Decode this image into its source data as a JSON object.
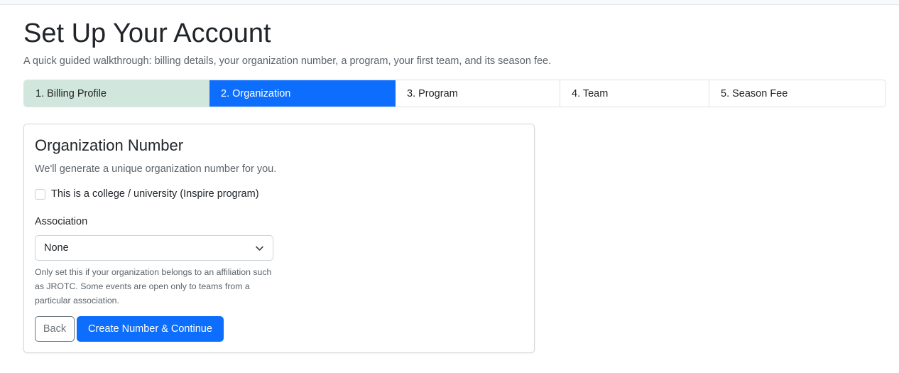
{
  "header": {
    "title": "Set Up Your Account",
    "subtitle": "A quick guided walkthrough: billing details, your organization number, a program, your first team, and its season fee."
  },
  "steps": [
    {
      "label": "1. Billing Profile",
      "state": "done"
    },
    {
      "label": "2. Organization",
      "state": "active"
    },
    {
      "label": "3. Program",
      "state": "pending"
    },
    {
      "label": "4. Team",
      "state": "pending"
    },
    {
      "label": "5. Season Fee",
      "state": "pending"
    }
  ],
  "card": {
    "title": "Organization Number",
    "description": "We'll generate a unique organization number for you.",
    "college_checkbox_label": "This is a college / university (Inspire program)",
    "college_checked": false,
    "association_label": "Association",
    "association_value": "None",
    "association_help": "Only set this if your organization belongs to an affiliation such as JROTC. Some events are open only to teams from a particular association.",
    "back_label": "Back",
    "continue_label": "Create Number & Continue"
  },
  "colors": {
    "primary": "#0d6efd",
    "done_step": "#d1e7dd",
    "muted_text": "#5c636a"
  }
}
